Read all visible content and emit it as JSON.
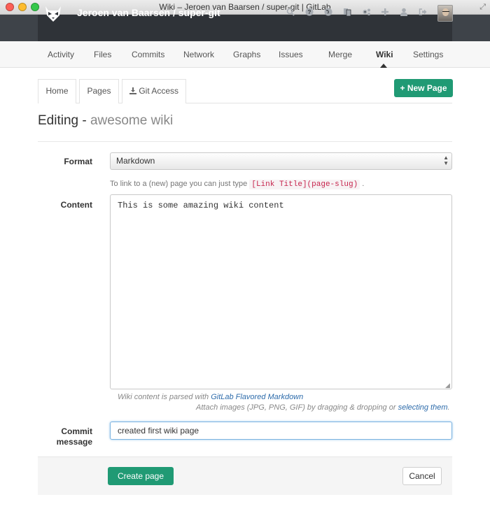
{
  "window": {
    "title": "Wiki – Jeroen van Baarsen / super-git | GitLab"
  },
  "header": {
    "project_title": "Jeroen van Baarsen / super-git",
    "icons": [
      "search-icon",
      "help-icon",
      "globe-icon",
      "snippets-icon",
      "admin-icon",
      "plus-icon",
      "user-icon",
      "logout-icon"
    ]
  },
  "nav": {
    "items": [
      "Activity",
      "Files",
      "Commits",
      "Network",
      "Graphs",
      "Issues",
      "Merge",
      "Wiki",
      "Settings"
    ],
    "active": "Wiki"
  },
  "subtabs": {
    "home": "Home",
    "pages": "Pages",
    "git_access": "Git Access"
  },
  "new_page_label": "New Page",
  "heading": {
    "prefix": "Editing - ",
    "page_name": "awesome wiki"
  },
  "form": {
    "format_label": "Format",
    "format_value": "Markdown",
    "hint_prefix": "To link to a (new) page you can just type",
    "hint_code": "[Link Title](page-slug)",
    "hint_suffix": ".",
    "content_label": "Content",
    "content_value": "This is some amazing wiki content",
    "parsed_prefix": "Wiki content is parsed with",
    "parsed_link": "GitLab Flavored Markdown",
    "attach_prefix": "Attach images (JPG, PNG, GIF) by dragging & dropping or",
    "attach_link": "selecting them",
    "attach_suffix": ".",
    "commit_label_line1": "Commit",
    "commit_label_line2": "message",
    "commit_value": "created first wiki page"
  },
  "actions": {
    "create_label": "Create page",
    "cancel_label": "Cancel"
  },
  "colors": {
    "accent": "#209a74",
    "header_bg": "#2f3338",
    "link": "#2e6cab"
  }
}
